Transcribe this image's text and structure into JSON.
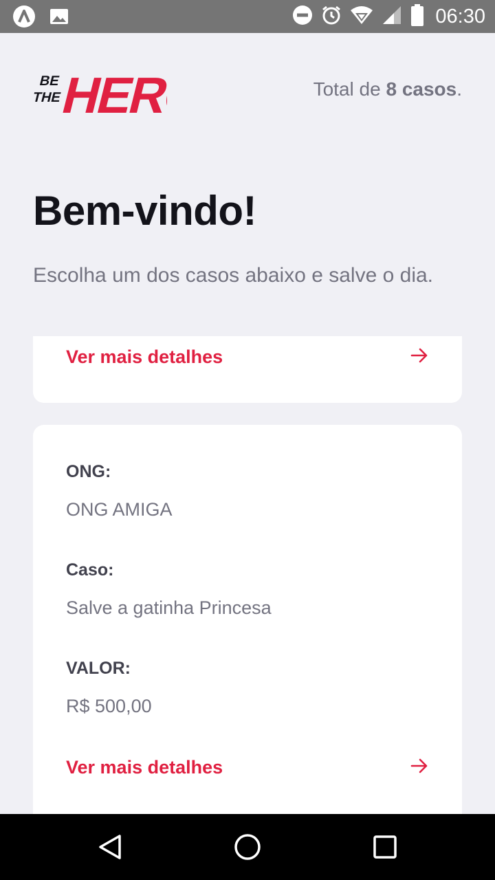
{
  "status_bar": {
    "time": "06:30",
    "icons": [
      "app-logo-icon",
      "image-icon",
      "do-not-disturb-icon",
      "alarm-icon",
      "wifi-icon",
      "signal-icon",
      "battery-icon"
    ]
  },
  "header": {
    "logo_alt": "Be The Hero",
    "total_prefix": "Total de",
    "total_count": "8 casos",
    "total_suffix": "."
  },
  "main": {
    "title": "Bem-vindo!",
    "subtitle": "Escolha um dos casos abaixo e salve o dia."
  },
  "cases": [
    {
      "details_label": "Ver mais detalhes"
    },
    {
      "ong_label": "ONG:",
      "ong_value": "ONG AMIGA",
      "case_label": "Caso:",
      "case_value": "Salve a gatinha Princesa",
      "value_label": "VALOR:",
      "value_value": "R$ 500,00",
      "details_label": "Ver mais detalhes"
    }
  ],
  "colors": {
    "brand": "#e02041",
    "background": "#f0f0f5",
    "text_dark": "#13131a",
    "text_muted": "#737380"
  }
}
